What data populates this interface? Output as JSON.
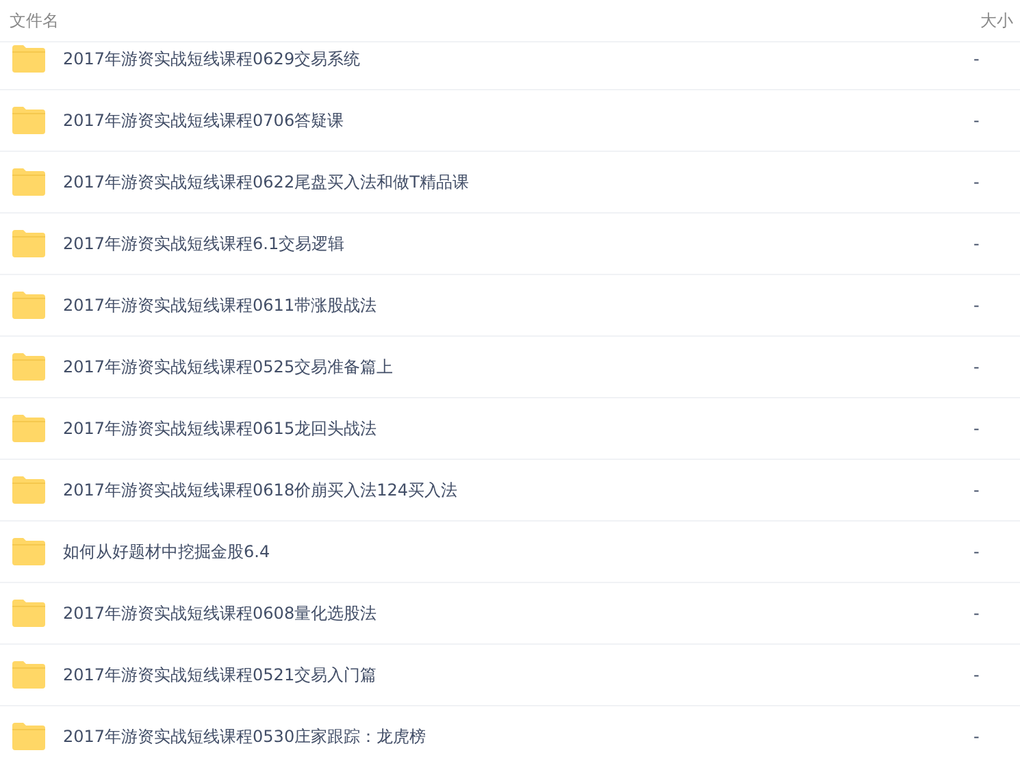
{
  "columns": [
    "文件名",
    "大小"
  ],
  "rows": [
    {
      "name": "2017年游资实战短线课程0629交易系统",
      "size": "-"
    },
    {
      "name": "2017年游资实战短线课程0706答疑课",
      "size": "-"
    },
    {
      "name": "2017年游资实战短线课程0622尾盘买入法和做T精品课",
      "size": "-"
    },
    {
      "name": "2017年游资实战短线课程6.1交易逻辑",
      "size": "-"
    },
    {
      "name": "2017年游资实战短线课程0611带涨股战法",
      "size": "-"
    },
    {
      "name": "2017年游资实战短线课程0525交易准备篇上",
      "size": "-"
    },
    {
      "name": "2017年游资实战短线课程0615龙回头战法",
      "size": "-"
    },
    {
      "name": "2017年游资实战短线课程0618价崩买入法124买入法",
      "size": "-"
    },
    {
      "name": "如何从好题材中挖掘金股6.4",
      "size": "-"
    },
    {
      "name": "2017年游资实战短线课程0608量化选股法",
      "size": "-"
    },
    {
      "name": "2017年游资实战短线课程0521交易入门篇",
      "size": "-"
    },
    {
      "name": "2017年游资实战短线课程0530庄家跟踪：龙虎榜",
      "size": "-"
    }
  ]
}
